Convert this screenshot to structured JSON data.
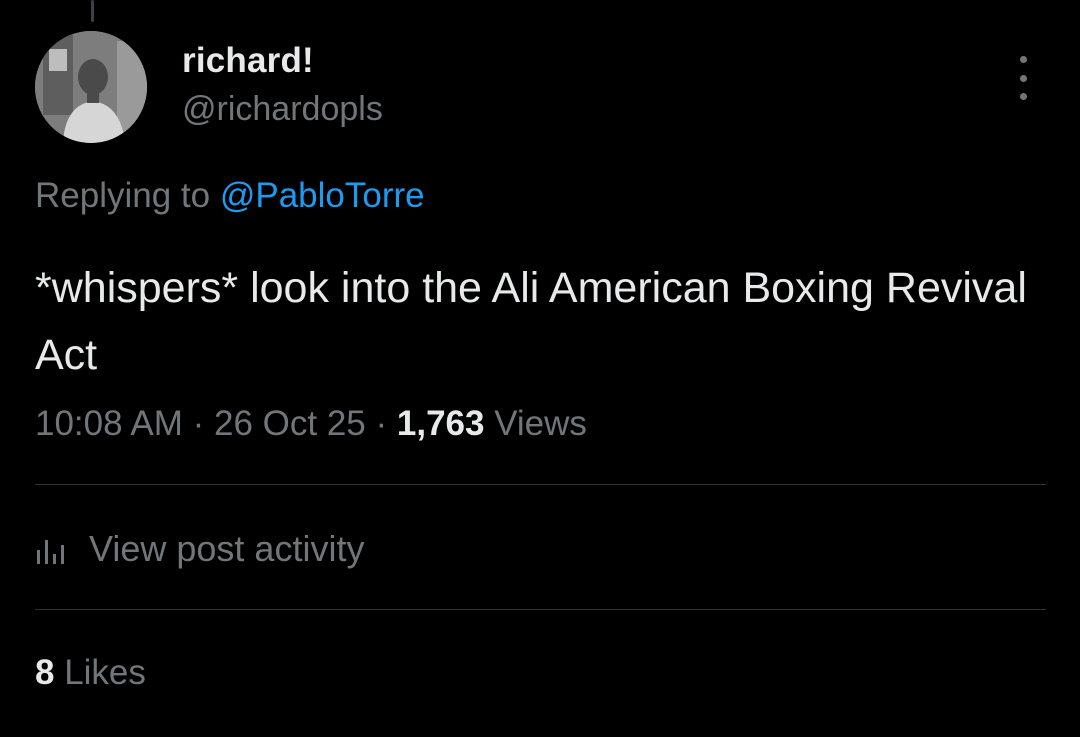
{
  "author": {
    "display_name": "richard!",
    "handle": "@richardopls"
  },
  "reply": {
    "prefix": "Replying to ",
    "mention": "@PabloTorre"
  },
  "tweet": {
    "text": "*whispers* look into the Ali American Boxing Revival Act"
  },
  "meta": {
    "time": "10:08 AM",
    "separator": " · ",
    "date": "26 Oct 25",
    "views_count": "1,763",
    "views_label": " Views"
  },
  "activity": {
    "label": "View post activity",
    "icon": "bar-chart-icon"
  },
  "likes": {
    "count": "8",
    "label": " Likes"
  },
  "colors": {
    "background": "#000000",
    "primary_text": "#e7e9ea",
    "secondary_text": "#71767b",
    "link": "#1d9bf0",
    "divider": "#2f3336"
  }
}
